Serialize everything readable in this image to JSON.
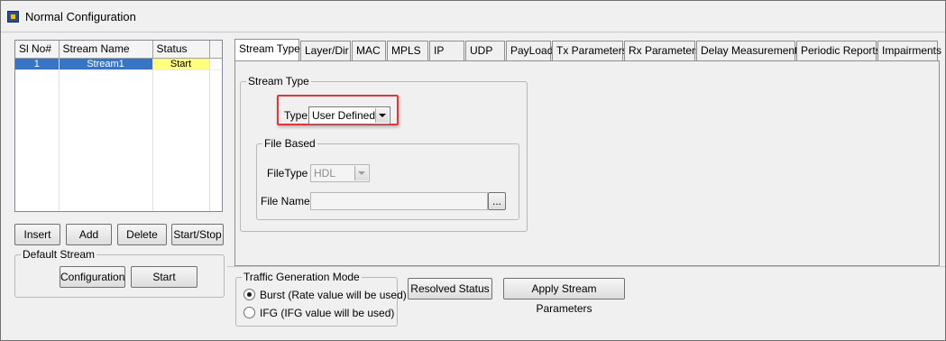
{
  "window": {
    "title": "Normal Configuration",
    "icon": "app-window-icon"
  },
  "stream_grid": {
    "columns": [
      "Sl No#",
      "Stream Name",
      "Status"
    ],
    "rows": [
      {
        "sl": "1",
        "name": "Stream1",
        "status": "Start"
      }
    ]
  },
  "stream_buttons": {
    "insert": "Insert",
    "add": "Add",
    "delete": "Delete",
    "start_stop": "Start/Stop"
  },
  "default_stream": {
    "legend": "Default Stream",
    "configuration": "Configuration",
    "start": "Start"
  },
  "tabs": [
    "Stream Type",
    "Layer/Dir",
    "MAC",
    "MPLS",
    "IP",
    "UDP",
    "PayLoad",
    "Tx Parameters",
    "Rx Parameters",
    "Delay Measurements",
    "Periodic Reports",
    "Impairments"
  ],
  "stream_type": {
    "legend": "Stream Type",
    "type_label": "Type",
    "type_value": "User Defined",
    "file_based": {
      "legend": "File Based",
      "filetype_label": "FileType",
      "filetype_value": "HDL",
      "filename_label": "File Name",
      "filename_value": "",
      "browse": "..."
    }
  },
  "traffic_mode": {
    "legend": "Traffic Generation Mode",
    "options": [
      {
        "label": "Burst (Rate value will be used)",
        "selected": true
      },
      {
        "label": "IFG (IFG value will be used)",
        "selected": false
      }
    ]
  },
  "actions": {
    "resolved_status": "Resolved Status",
    "apply": "Apply Stream Parameters"
  },
  "colors": {
    "selection": "#3875c4",
    "status_cell": "#ffff80",
    "highlight_border": "#e5323b"
  }
}
